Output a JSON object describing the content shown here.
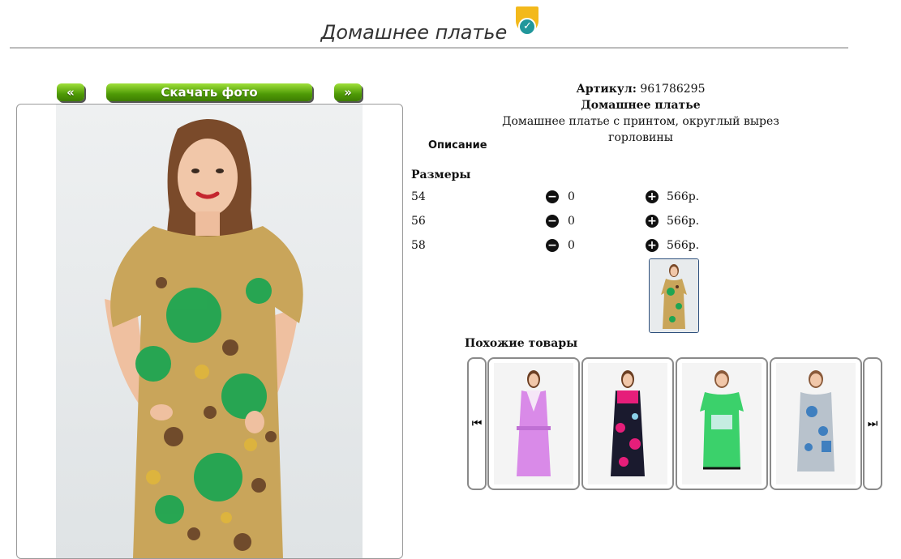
{
  "header": {
    "title": "Домашнее платье",
    "badge_icon": "verified-check-icon"
  },
  "toolbar": {
    "prev_label": "«",
    "download_label": "Скачать фото",
    "next_label": "»",
    "accent_color": "#5aa30f"
  },
  "product": {
    "article_label": "Артикул:",
    "article_value": "961786295",
    "name": "Домашнее платье",
    "description": "Домашнее платье с принтом, округлый вырез горловины",
    "description_heading": "Описание",
    "sizes_heading": "Размеры",
    "sizes": [
      {
        "size": "54",
        "qty": "0",
        "price": "566р."
      },
      {
        "size": "56",
        "qty": "0",
        "price": "566р."
      },
      {
        "size": "58",
        "qty": "0",
        "price": "566р."
      }
    ]
  },
  "similar": {
    "heading": "Похожие товары",
    "prev_icon": "skip-previous-icon",
    "next_icon": "skip-next-icon",
    "items": [
      {
        "color": "#d98ae8",
        "name": "pink-robe"
      },
      {
        "color": "#1a1a2e",
        "name": "floral-dress"
      },
      {
        "color": "#3bd16b",
        "name": "green-dress"
      },
      {
        "color": "#b8c2cc",
        "name": "grey-dress"
      }
    ]
  }
}
